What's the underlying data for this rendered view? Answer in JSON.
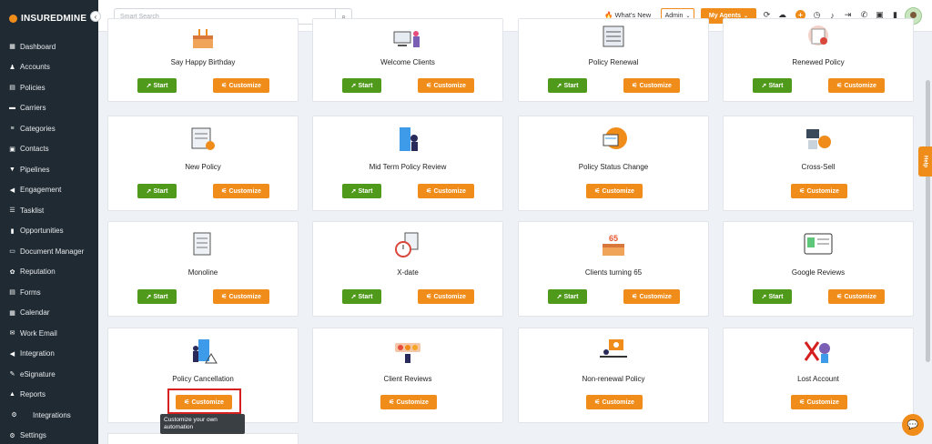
{
  "brand": {
    "name": "INSUREDMINE"
  },
  "sidebar": {
    "items": [
      {
        "label": "Dashboard",
        "icon": "dashboard-icon",
        "glyph": "▦"
      },
      {
        "label": "Accounts",
        "icon": "accounts-icon",
        "glyph": "♟"
      },
      {
        "label": "Policies",
        "icon": "policies-icon",
        "glyph": "▤"
      },
      {
        "label": "Carriers",
        "icon": "carriers-icon",
        "glyph": "▬"
      },
      {
        "label": "Categories",
        "icon": "categories-icon",
        "glyph": "≡"
      },
      {
        "label": "Contacts",
        "icon": "contacts-icon",
        "glyph": "▣"
      },
      {
        "label": "Pipelines",
        "icon": "pipelines-icon",
        "glyph": "▼"
      },
      {
        "label": "Engagement",
        "icon": "engagement-icon",
        "glyph": "◀"
      },
      {
        "label": "Tasklist",
        "icon": "tasklist-icon",
        "glyph": "☰"
      },
      {
        "label": "Opportunities",
        "icon": "opportunities-icon",
        "glyph": "▮"
      },
      {
        "label": "Document Manager",
        "icon": "folder-icon",
        "glyph": "▭"
      },
      {
        "label": "Reputation",
        "icon": "reputation-icon",
        "glyph": "✿"
      },
      {
        "label": "Forms",
        "icon": "forms-icon",
        "glyph": "▤"
      },
      {
        "label": "Calendar",
        "icon": "calendar-icon",
        "glyph": "▦"
      },
      {
        "label": "Work Email",
        "icon": "email-icon",
        "glyph": "✉"
      },
      {
        "label": "Integration",
        "icon": "integration-icon",
        "glyph": "◀"
      },
      {
        "label": "eSignature",
        "icon": "esignature-icon",
        "glyph": "✎"
      },
      {
        "label": "Reports",
        "icon": "reports-icon",
        "glyph": "▲"
      },
      {
        "label": "Integrations",
        "icon": "integrations-icon",
        "glyph": "⚙"
      },
      {
        "label": "Settings",
        "icon": "settings-icon",
        "glyph": "⚙"
      }
    ]
  },
  "topbar": {
    "search_placeholder": "Smart Search",
    "whats_new": "What's New",
    "admin": "Admin",
    "my_agents": "My Agents"
  },
  "buttons": {
    "start": "Start",
    "customize": "Customize"
  },
  "tooltip": "Customize your own automation",
  "help_label": "Help",
  "cards": [
    {
      "title": "Say Happy Birthday",
      "start": true,
      "illustration": "birthday-cake-illustration"
    },
    {
      "title": "Welcome Clients",
      "start": true,
      "illustration": "welcome-illustration"
    },
    {
      "title": "Policy Renewal",
      "start": true,
      "illustration": "policy-renewal-illustration"
    },
    {
      "title": "Renewed Policy",
      "start": true,
      "illustration": "renewed-policy-illustration"
    },
    {
      "title": "New Policy",
      "start": true,
      "illustration": "new-policy-illustration"
    },
    {
      "title": "Mid Term Policy Review",
      "start": true,
      "illustration": "review-illustration"
    },
    {
      "title": "Policy Status Change",
      "start": false,
      "illustration": "status-change-illustration"
    },
    {
      "title": "Cross-Sell",
      "start": false,
      "illustration": "cross-sell-illustration"
    },
    {
      "title": "Monoline",
      "start": true,
      "illustration": "monoline-illustration"
    },
    {
      "title": "X-date",
      "start": true,
      "illustration": "x-date-illustration"
    },
    {
      "title": "Clients turning 65",
      "start": true,
      "illustration": "cake-65-illustration",
      "badge": "65"
    },
    {
      "title": "Google Reviews",
      "start": true,
      "illustration": "google-reviews-illustration"
    },
    {
      "title": "Policy Cancellation",
      "start": false,
      "illustration": "cancellation-illustration"
    },
    {
      "title": "Client Reviews",
      "start": false,
      "illustration": "client-reviews-illustration"
    },
    {
      "title": "Non-renewal Policy",
      "start": false,
      "illustration": "non-renewal-illustration"
    },
    {
      "title": "Lost Account",
      "start": false,
      "illustration": "lost-account-illustration"
    }
  ],
  "colors": {
    "sidebar_bg": "#1f2a33",
    "accent_orange": "#f08c1a",
    "start_green": "#4f9a1a",
    "highlight_red": "#d61f1f"
  }
}
